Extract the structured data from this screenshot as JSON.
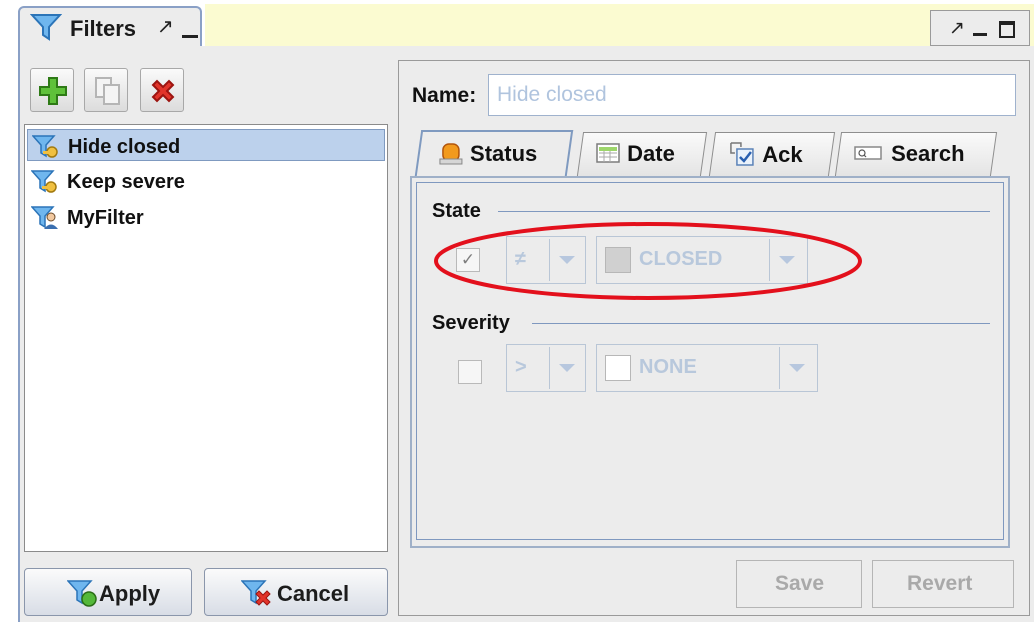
{
  "app": {
    "panel_title": "Filters"
  },
  "toolbar": {
    "add_icon": "add-plus-icon",
    "copy_icon": "copy-icon",
    "delete_icon": "delete-x-icon"
  },
  "filter_list": {
    "items": [
      {
        "label": "Hide closed",
        "icon": "filter-key-icon",
        "selected": true
      },
      {
        "label": "Keep severe",
        "icon": "filter-key-icon",
        "selected": false
      },
      {
        "label": "MyFilter",
        "icon": "filter-user-icon",
        "selected": false
      }
    ]
  },
  "actions": {
    "apply_label": "Apply",
    "cancel_label": "Cancel"
  },
  "editor": {
    "name_label": "Name:",
    "name_value": "Hide closed",
    "tabs": [
      {
        "label": "Status",
        "icon": "alarm-bell-icon",
        "active": true
      },
      {
        "label": "Date",
        "icon": "calendar-icon",
        "active": false
      },
      {
        "label": "Ack",
        "icon": "checkbox-icon",
        "active": false
      },
      {
        "label": "Search",
        "icon": "search-icon",
        "active": false
      }
    ],
    "state": {
      "label": "State",
      "checked": true,
      "check_glyph": "✓",
      "operator": "≠",
      "value": "CLOSED",
      "swatch_color": "#d0d0d0"
    },
    "severity": {
      "label": "Severity",
      "checked": false,
      "operator": ">",
      "value": "NONE",
      "swatch_color": "#ffffff"
    },
    "save_label": "Save",
    "revert_label": "Revert"
  },
  "colors": {
    "annotation": "#e3101c",
    "selection": "#bcd1ec",
    "tab_bar": "#fbfbd1"
  }
}
